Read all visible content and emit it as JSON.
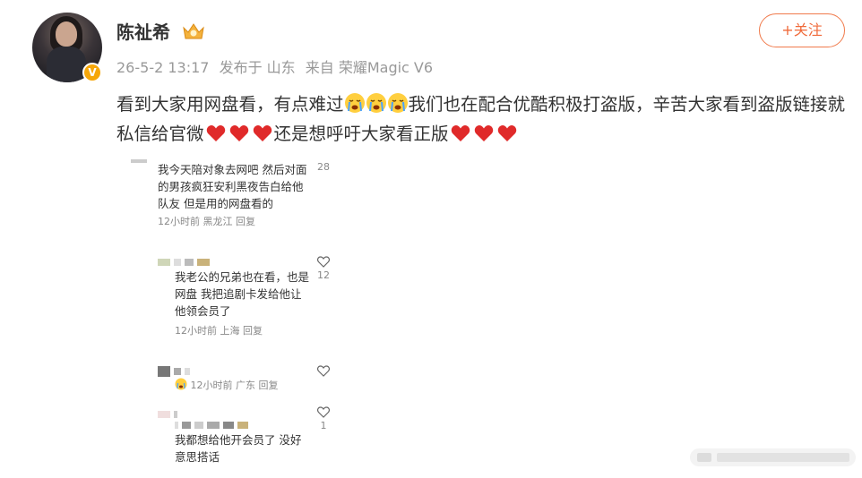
{
  "post": {
    "author": "陈祉希",
    "time": "26-5-2 13:17",
    "location": "发布于 山东",
    "source": "来自 荣耀Magic V6",
    "follow_label": "+关注",
    "text_1": "看到大家用网盘看，有点难过",
    "text_2": "我们也在配合优酷积极打盗版，辛苦大家看到盗版链接就私信给官微",
    "text_3": "还是想呼吁大家看正版",
    "icons": {
      "verified": "v-badge",
      "crown": "crown-icon",
      "cry": "crying-emoji",
      "heart": "heart-emoji"
    },
    "colors": {
      "follow": "#f06a3a",
      "heart": "#e02a2a",
      "badge": "#f6a70a"
    }
  },
  "screenshot": {
    "comments": [
      {
        "text": "我今天陪对象去网吧 然后对面的男孩疯狂安利黑夜告白给他队友 但是用的网盘看的",
        "meta": "12小时前 黑龙江  回复",
        "likes": "28"
      },
      {
        "text": "我老公的兄弟也在看，也是网盘  我把追剧卡发给他让他领会员了",
        "meta": "12小时前 上海  回复",
        "likes": "12"
      },
      {
        "text": "",
        "meta": "12小时前 广东  回复",
        "likes": ""
      },
      {
        "text": "我都想给他开会员了 没好意思搭话",
        "meta": "",
        "likes": "1"
      }
    ]
  }
}
